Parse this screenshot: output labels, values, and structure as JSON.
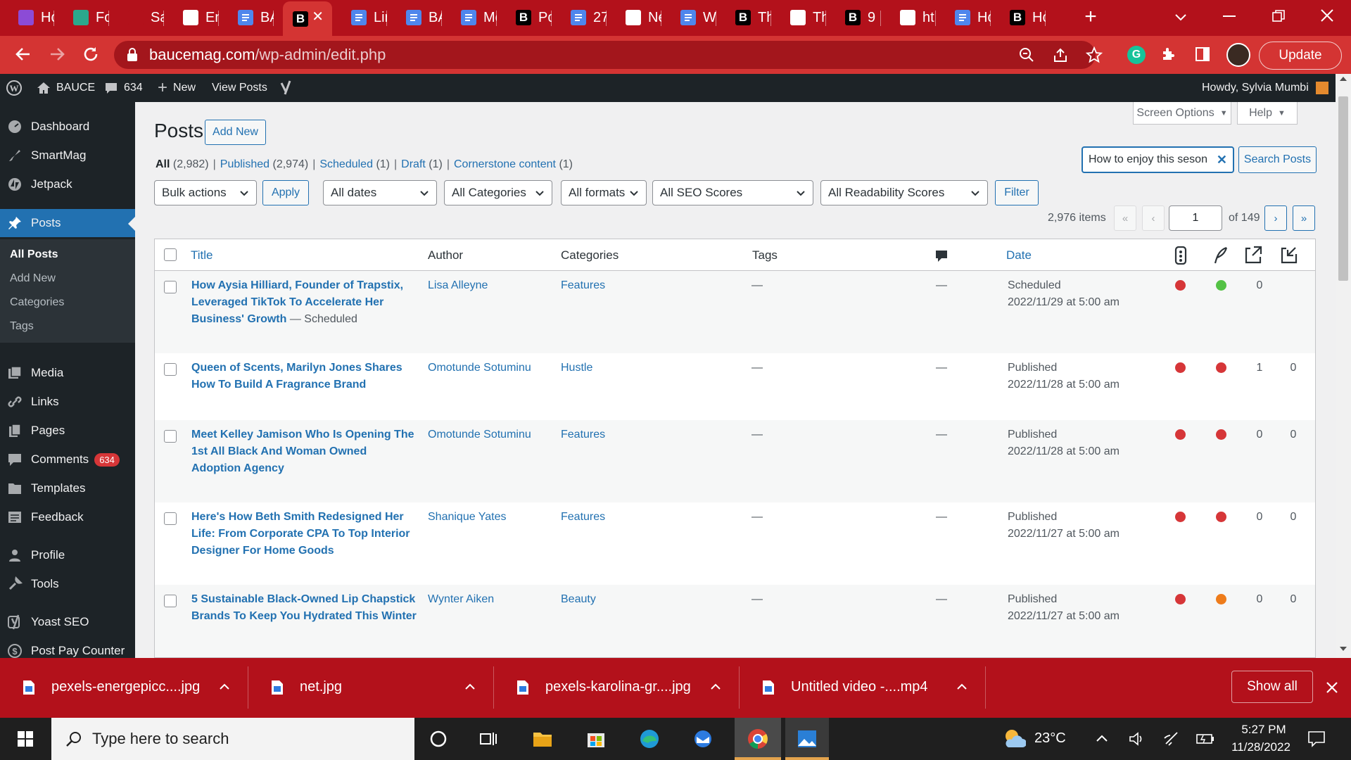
{
  "browser": {
    "tabs": [
      {
        "label": "Hc",
        "favicon": "purple"
      },
      {
        "label": "Fo",
        "favicon": "green"
      },
      {
        "label": "Sa",
        "favicon": "pink"
      },
      {
        "label": "En",
        "favicon": "mail"
      },
      {
        "label": "BA",
        "favicon": "docs"
      },
      {
        "label": "B",
        "favicon": "bold",
        "active": true
      },
      {
        "label": "Lir",
        "favicon": "docs"
      },
      {
        "label": "BA",
        "favicon": "docs"
      },
      {
        "label": "Mc",
        "favicon": "docs"
      },
      {
        "label": "Po",
        "favicon": "bold"
      },
      {
        "label": "27",
        "favicon": "docs"
      },
      {
        "label": "Ne",
        "favicon": "chrome"
      },
      {
        "label": "WI",
        "favicon": "docs"
      },
      {
        "label": "Th",
        "favicon": "bold"
      },
      {
        "label": "Th",
        "favicon": "image"
      },
      {
        "label": "9",
        "favicon": "bold"
      },
      {
        "label": "ht",
        "favicon": "paypal"
      },
      {
        "label": "Hc",
        "favicon": "docs"
      },
      {
        "label": "Hc",
        "favicon": "bold"
      }
    ],
    "url_domain": "baucemag.com",
    "url_path": "/wp-admin/edit.php",
    "update_label": "Update",
    "accent": "#d43433",
    "tabbar_color": "#b3111b"
  },
  "adminbar": {
    "site_name": "BAUCE",
    "comments_count": "634",
    "new_label": "New",
    "view_posts_label": "View Posts",
    "howdy": "Howdy, Sylvia Mumbi"
  },
  "sidebar": {
    "items": [
      {
        "label": "Dashboard",
        "icon": "dashboard-icon"
      },
      {
        "label": "SmartMag",
        "icon": "brush-icon"
      },
      {
        "label": "Jetpack",
        "icon": "jetpack-icon"
      },
      {
        "label": "Posts",
        "icon": "pin-icon",
        "active": true
      },
      {
        "label": "Media",
        "icon": "media-icon"
      },
      {
        "label": "Links",
        "icon": "links-icon"
      },
      {
        "label": "Pages",
        "icon": "pages-icon"
      },
      {
        "label": "Comments",
        "icon": "comments-icon",
        "badge": "634"
      },
      {
        "label": "Templates",
        "icon": "folder-icon"
      },
      {
        "label": "Feedback",
        "icon": "feedback-icon"
      },
      {
        "label": "Profile",
        "icon": "profile-icon"
      },
      {
        "label": "Tools",
        "icon": "tools-icon"
      },
      {
        "label": "Yoast SEO",
        "icon": "yoast-icon"
      },
      {
        "label": "Post Pay Counter",
        "icon": "dollar-icon"
      }
    ],
    "submenu": [
      "All Posts",
      "Add New",
      "Categories",
      "Tags"
    ]
  },
  "main": {
    "heading": "Posts",
    "add_new": "Add New",
    "screen_options": "Screen Options",
    "help": "Help",
    "views": [
      {
        "label": "All",
        "count": "(2,982)",
        "current": true
      },
      {
        "label": "Published",
        "count": "(2,974)"
      },
      {
        "label": "Scheduled",
        "count": "(1)"
      },
      {
        "label": "Draft",
        "count": "(1)"
      },
      {
        "label": "Cornerstone content",
        "count": "(1)"
      }
    ],
    "search_value": "How to enjoy this seson",
    "search_button": "Search Posts",
    "filters": {
      "bulk": "Bulk actions",
      "apply": "Apply",
      "dates": "All dates",
      "categories": "All Categories",
      "formats": "All formats",
      "seo": "All SEO Scores",
      "readability": "All Readability Scores",
      "filter": "Filter"
    },
    "pagination": {
      "items": "2,976 items",
      "first": "«",
      "prev": "‹",
      "current": "1",
      "of": "of 149",
      "next": "›",
      "last": "»"
    },
    "table": {
      "columns": {
        "title": "Title",
        "author": "Author",
        "categories": "Categories",
        "tags": "Tags",
        "date": "Date"
      },
      "rows": [
        {
          "title": "How Aysia Hilliard, Founder of Trapstix, Leveraged TikTok To Accelerate Her Business' Growth",
          "state": " — Scheduled",
          "author": "Lisa Alleyne",
          "category": "Features",
          "tags": "—",
          "comments": "—",
          "status": "Scheduled",
          "date": "2022/11/29 at 5:00 am",
          "seo": "#d63638",
          "readability": "#54c245",
          "links_in": "0",
          "links_out": ""
        },
        {
          "title": "Queen of Scents, Marilyn Jones Shares How To Build A Fragrance Brand",
          "state": "",
          "author": "Omotunde Sotuminu",
          "category": "Hustle",
          "tags": "—",
          "comments": "—",
          "status": "Published",
          "date": "2022/11/28 at 5:00 am",
          "seo": "#d63638",
          "readability": "#d63638",
          "links_in": "1",
          "links_out": "0"
        },
        {
          "title": "Meet Kelley Jamison Who Is Opening The 1st All Black And Woman Owned Adoption Agency",
          "state": "",
          "author": "Omotunde Sotuminu",
          "category": "Features",
          "tags": "—",
          "comments": "—",
          "status": "Published",
          "date": "2022/11/28 at 5:00 am",
          "seo": "#d63638",
          "readability": "#d63638",
          "links_in": "0",
          "links_out": "0"
        },
        {
          "title": "Here's How Beth Smith Redesigned Her Life: From Corporate CPA To Top Interior Designer For Home Goods",
          "state": "",
          "author": "Shanique Yates",
          "category": "Features",
          "tags": "—",
          "comments": "—",
          "status": "Published",
          "date": "2022/11/27 at 5:00 am",
          "seo": "#d63638",
          "readability": "#d63638",
          "links_in": "0",
          "links_out": "0"
        },
        {
          "title": "5 Sustainable Black-Owned Lip Chapstick Brands To Keep You Hydrated This Winter",
          "state": "",
          "author": "Wynter Aiken",
          "category": "Beauty",
          "tags": "—",
          "comments": "—",
          "status": "Published",
          "date": "2022/11/27 at 5:00 am",
          "seo": "#d63638",
          "readability": "#ee7c1b",
          "links_in": "0",
          "links_out": "0"
        }
      ]
    }
  },
  "downloads": {
    "items": [
      "pexels-energepicc....jpg",
      "net.jpg",
      "pexels-karolina-gr....jpg",
      "Untitled video -....mp4"
    ],
    "show_all": "Show all"
  },
  "taskbar": {
    "search_placeholder": "Type here to search",
    "temperature": "23°C",
    "time": "5:27 PM",
    "date": "11/28/2022"
  }
}
